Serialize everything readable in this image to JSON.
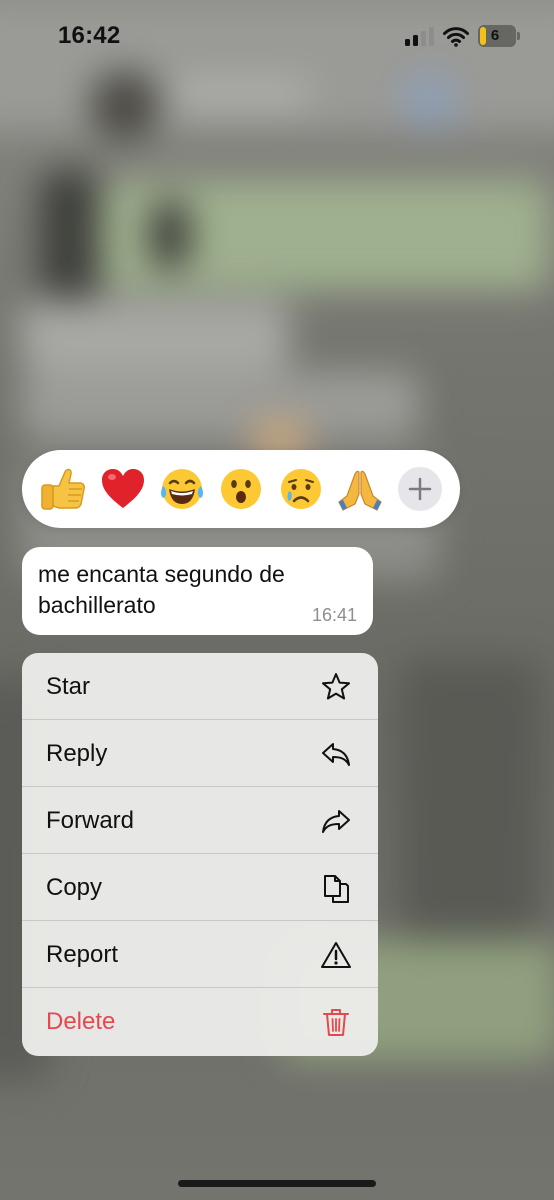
{
  "status_bar": {
    "time": "16:42",
    "battery_level": "6",
    "battery_color": "#f2c21a",
    "icons": [
      "signal-icon",
      "wifi-icon",
      "battery-icon"
    ]
  },
  "reactions": {
    "items": [
      {
        "name": "thumbs-up",
        "icon": "thumbs-up-icon"
      },
      {
        "name": "red-heart",
        "icon": "heart-icon"
      },
      {
        "name": "tears-of-joy",
        "icon": "laughing-face-icon"
      },
      {
        "name": "open-mouth",
        "icon": "surprised-face-icon"
      },
      {
        "name": "crying-face",
        "icon": "crying-face-icon"
      },
      {
        "name": "folded-hands",
        "icon": "praying-hands-icon"
      }
    ],
    "more_icon": "plus-icon"
  },
  "message": {
    "text": "me encanta segundo de bachillerato",
    "time": "16:41"
  },
  "context_menu": {
    "items": [
      {
        "label": "Star",
        "icon": "star-icon"
      },
      {
        "label": "Reply",
        "icon": "reply-icon"
      },
      {
        "label": "Forward",
        "icon": "forward-icon"
      },
      {
        "label": "Copy",
        "icon": "copy-icon"
      },
      {
        "label": "Report",
        "icon": "warning-icon"
      },
      {
        "label": "Delete",
        "icon": "trash-icon",
        "destructive_color": "#e5484d"
      }
    ]
  }
}
